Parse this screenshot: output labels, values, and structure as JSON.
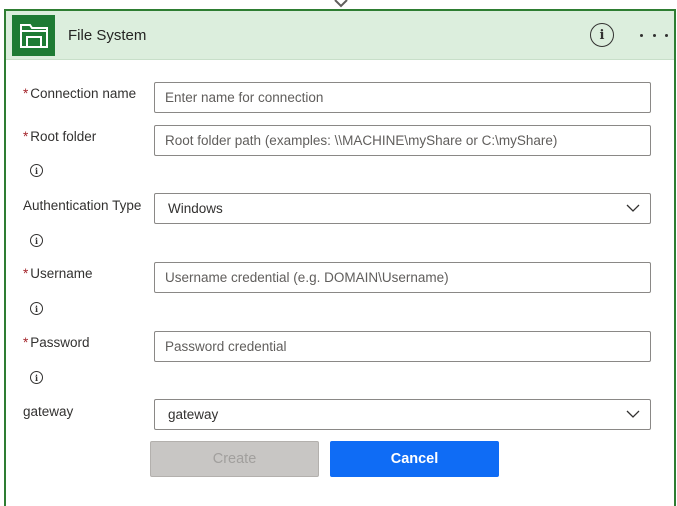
{
  "header": {
    "title": "File System",
    "icon": "file-system-icon",
    "info_icon": "info-icon",
    "more_icon": "more-options-icon"
  },
  "form": {
    "connection_name": {
      "label": "Connection name",
      "required": true,
      "placeholder": "Enter name for connection",
      "value": ""
    },
    "root_folder": {
      "label": "Root folder",
      "required": true,
      "placeholder": "Root folder path (examples: \\\\MACHINE\\myShare or C:\\myShare)",
      "value": ""
    },
    "authentication_type": {
      "label": "Authentication Type",
      "required": false,
      "selected": "Windows"
    },
    "username": {
      "label": "Username",
      "required": true,
      "placeholder": "Username credential (e.g. DOMAIN\\Username)",
      "value": ""
    },
    "password": {
      "label": "Password",
      "required": true,
      "placeholder": "Password credential",
      "value": ""
    },
    "gateway": {
      "label": "gateway",
      "required": false,
      "selected": "gateway"
    },
    "required_marker": "*",
    "info_glyph": "i"
  },
  "actions": {
    "create_label": "Create",
    "cancel_label": "Cancel"
  },
  "colors": {
    "header_bg": "#dceedd",
    "border": "#2e7d32",
    "app_icon_bg": "#1e7b34",
    "primary": "#0f6cf5",
    "disabled": "#c8c6c4",
    "required": "#a4262c"
  }
}
